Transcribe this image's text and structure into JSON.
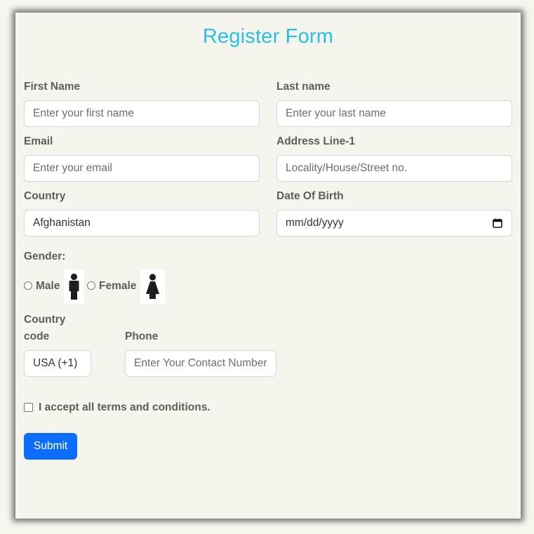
{
  "form": {
    "title": "Register Form",
    "first_name": {
      "label": "First Name",
      "placeholder": "Enter your first name"
    },
    "last_name": {
      "label": "Last name",
      "placeholder": "Enter your last name"
    },
    "email": {
      "label": "Email",
      "placeholder": "Enter your email"
    },
    "address": {
      "label": "Address Line-1",
      "placeholder": "Locality/House/Street no."
    },
    "country": {
      "label": "Country",
      "value": "Afghanistan"
    },
    "dob": {
      "label": "Date Of Birth",
      "value": "mm/dd/yyyy",
      "icon": "calendar-icon"
    },
    "gender": {
      "label": "Gender:",
      "options": [
        {
          "label": "Male",
          "icon": "male-icon"
        },
        {
          "label": "Female",
          "icon": "female-icon"
        }
      ]
    },
    "country_code": {
      "label_line1": "Country",
      "label_line2": "code",
      "value": "USA (+1)"
    },
    "phone": {
      "label": "Phone",
      "placeholder": "Enter Your Contact Number"
    },
    "terms": {
      "label": "I accept all terms and conditions."
    },
    "submit_label": "Submit"
  },
  "colors": {
    "title": "#27c0e6",
    "submit_bg": "#0d6efd",
    "page_bg": "#f5f5ed",
    "label": "#5d5d5d"
  }
}
